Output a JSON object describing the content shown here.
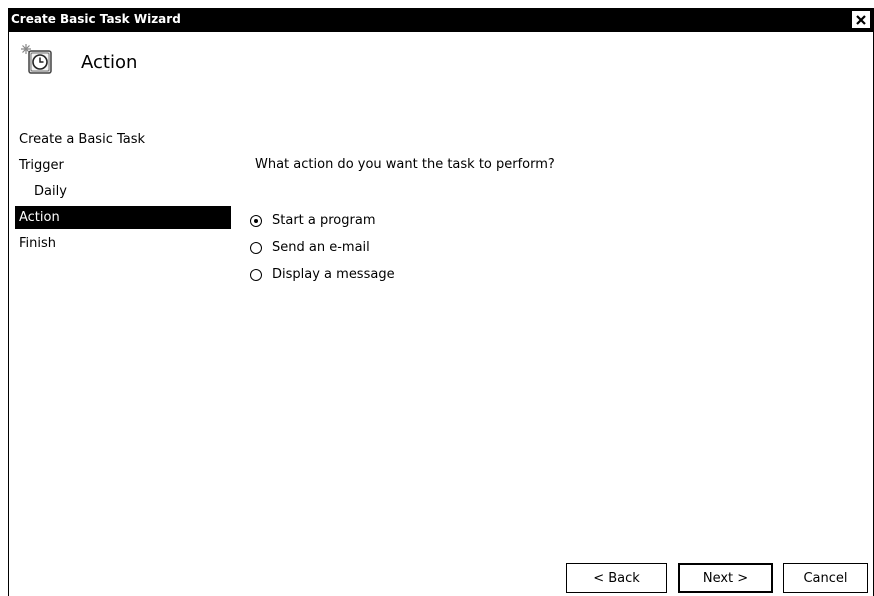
{
  "window": {
    "title": "Create Basic Task Wizard"
  },
  "header": {
    "title": "Action",
    "icon": "task-scheduler-clock-icon"
  },
  "nav": {
    "items": [
      {
        "label": "Create a Basic Task",
        "active": false
      },
      {
        "label": "Trigger",
        "active": false
      },
      {
        "label": "Daily",
        "active": false
      },
      {
        "label": "Action",
        "active": true
      },
      {
        "label": "Finish",
        "active": false
      }
    ]
  },
  "main": {
    "question": "What action do you want the task to perform?",
    "options": [
      {
        "label": "Start a program",
        "checked": true
      },
      {
        "label": "Send an e-mail",
        "checked": false
      },
      {
        "label": "Display a message",
        "checked": false
      }
    ]
  },
  "buttons": {
    "back": "< Back",
    "next": "Next >",
    "cancel": "Cancel"
  }
}
